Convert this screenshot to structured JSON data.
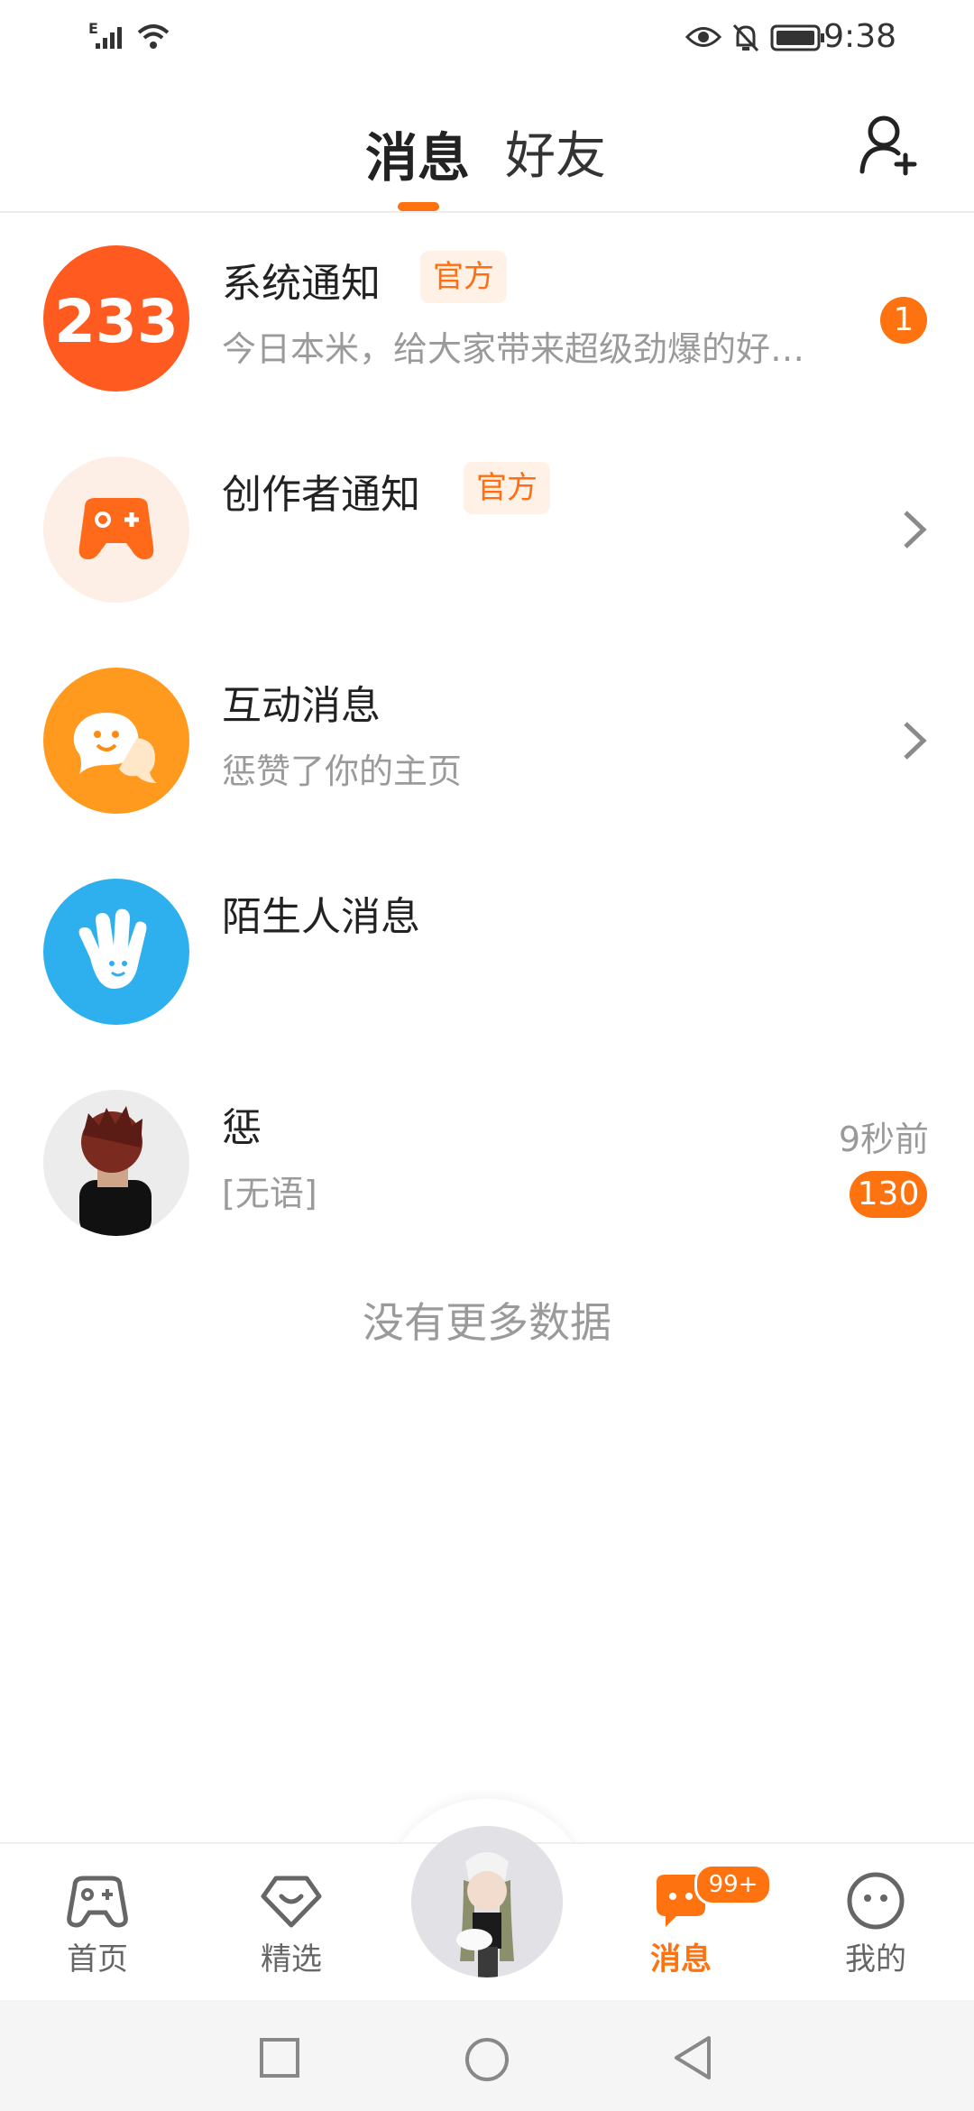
{
  "status_bar": {
    "time": "9:38",
    "network": "E"
  },
  "header": {
    "tabs": [
      {
        "label": "消息",
        "active": true
      },
      {
        "label": "好友",
        "active": false
      }
    ],
    "accent": "#ff7210"
  },
  "messages": [
    {
      "title": "系统通知",
      "tag": "官方",
      "preview": "今日本米，给大家带来超级劲爆的好…",
      "badge": "1",
      "avatar_text": "233"
    },
    {
      "title": "创作者通知",
      "tag": "官方",
      "preview": ""
    },
    {
      "title": "互动消息",
      "preview": "惩赞了你的主页"
    },
    {
      "title": "陌生人消息",
      "preview": ""
    },
    {
      "title": "惩",
      "preview": "[无语]",
      "time": "9秒前",
      "badge": "130"
    }
  ],
  "empty_text": "没有更多数据",
  "bottom_nav": {
    "items": [
      {
        "label": "首页",
        "icon": "gamepad-icon"
      },
      {
        "label": "精选",
        "icon": "heart-box-icon"
      },
      {
        "label": "消息",
        "icon": "message-icon",
        "badge": "99+",
        "active": true
      },
      {
        "label": "我的",
        "icon": "face-icon"
      }
    ]
  },
  "colors": {
    "accent": "#ff7210",
    "tag_bg": "#fff1e6",
    "sub_text": "#9a9a9a"
  }
}
